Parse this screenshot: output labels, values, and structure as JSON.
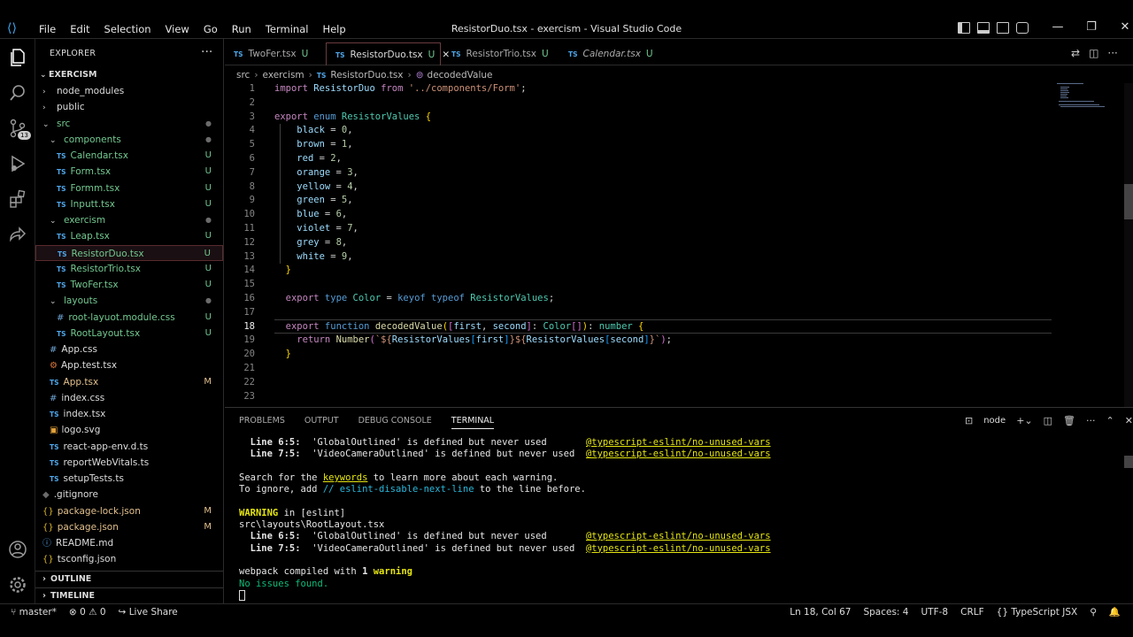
{
  "window": {
    "title": "ResistorDuo.tsx - exercism - Visual Studio Code",
    "menu": [
      "File",
      "Edit",
      "Selection",
      "View",
      "Go",
      "Run",
      "Terminal",
      "Help"
    ],
    "controls": [
      "—",
      "❐",
      "✕"
    ]
  },
  "activity": {
    "items": [
      "explorer-icon",
      "search-icon",
      "source-control-icon",
      "run-debug-icon",
      "extensions-icon",
      "live-share-icon"
    ],
    "scm_badge": "13",
    "bottom": [
      "account-icon",
      "manage-gear-icon"
    ]
  },
  "explorer": {
    "header": "EXPLORER",
    "more": "···",
    "root": "EXERCISM",
    "rows": [
      {
        "label": "node_modules",
        "kind": "folder-closed",
        "indent": 1,
        "deco": "",
        "color": ""
      },
      {
        "label": "public",
        "kind": "folder-closed",
        "indent": 1,
        "deco": "",
        "color": ""
      },
      {
        "label": "src",
        "kind": "folder-open",
        "indent": 1,
        "deco": "●",
        "color": "green"
      },
      {
        "label": "components",
        "kind": "folder-open",
        "indent": 2,
        "deco": "●",
        "color": "green"
      },
      {
        "label": "Calendar.tsx",
        "kind": "ts",
        "indent": 3,
        "deco": "U",
        "color": "green"
      },
      {
        "label": "Form.tsx",
        "kind": "ts",
        "indent": 3,
        "deco": "U",
        "color": "green"
      },
      {
        "label": "Formm.tsx",
        "kind": "ts",
        "indent": 3,
        "deco": "U",
        "color": "green"
      },
      {
        "label": "Inputt.tsx",
        "kind": "ts",
        "indent": 3,
        "deco": "U",
        "color": "green"
      },
      {
        "label": "exercism",
        "kind": "folder-open",
        "indent": 2,
        "deco": "●",
        "color": "green"
      },
      {
        "label": "Leap.tsx",
        "kind": "ts",
        "indent": 3,
        "deco": "U",
        "color": "green"
      },
      {
        "label": "ResistorDuo.tsx",
        "kind": "ts",
        "indent": 3,
        "deco": "U",
        "color": "green",
        "selected": true
      },
      {
        "label": "ResistorTrio.tsx",
        "kind": "ts",
        "indent": 3,
        "deco": "U",
        "color": "green"
      },
      {
        "label": "TwoFer.tsx",
        "kind": "ts",
        "indent": 3,
        "deco": "U",
        "color": "green"
      },
      {
        "label": "layouts",
        "kind": "folder-open",
        "indent": 2,
        "deco": "●",
        "color": "green"
      },
      {
        "label": "root-layuot.module.css",
        "kind": "css",
        "indent": 3,
        "deco": "U",
        "color": "green"
      },
      {
        "label": "RootLayout.tsx",
        "kind": "ts",
        "indent": 3,
        "deco": "U",
        "color": "green"
      },
      {
        "label": "App.css",
        "kind": "css",
        "indent": 2,
        "deco": "",
        "color": ""
      },
      {
        "label": "App.test.tsx",
        "kind": "test",
        "indent": 2,
        "deco": "",
        "color": ""
      },
      {
        "label": "App.tsx",
        "kind": "ts",
        "indent": 2,
        "deco": "M",
        "color": "yellow"
      },
      {
        "label": "index.css",
        "kind": "css",
        "indent": 2,
        "deco": "",
        "color": ""
      },
      {
        "label": "index.tsx",
        "kind": "ts",
        "indent": 2,
        "deco": "",
        "color": ""
      },
      {
        "label": "logo.svg",
        "kind": "svg",
        "indent": 2,
        "deco": "",
        "color": ""
      },
      {
        "label": "react-app-env.d.ts",
        "kind": "ts",
        "indent": 2,
        "deco": "",
        "color": ""
      },
      {
        "label": "reportWebVitals.ts",
        "kind": "ts",
        "indent": 2,
        "deco": "",
        "color": ""
      },
      {
        "label": "setupTests.ts",
        "kind": "ts",
        "indent": 2,
        "deco": "",
        "color": ""
      },
      {
        "label": ".gitignore",
        "kind": "git",
        "indent": 1,
        "deco": "",
        "color": ""
      },
      {
        "label": "package-lock.json",
        "kind": "json",
        "indent": 1,
        "deco": "M",
        "color": "yellow"
      },
      {
        "label": "package.json",
        "kind": "json",
        "indent": 1,
        "deco": "M",
        "color": "yellow"
      },
      {
        "label": "README.md",
        "kind": "md",
        "indent": 1,
        "deco": "",
        "color": ""
      },
      {
        "label": "tsconfig.json",
        "kind": "json",
        "indent": 1,
        "deco": "",
        "color": ""
      }
    ],
    "outline": "OUTLINE",
    "timeline": "TIMELINE"
  },
  "tabs": [
    {
      "label": "TwoFer.tsx",
      "badge": "U",
      "active": false,
      "italic": false
    },
    {
      "label": "ResistorDuo.tsx",
      "badge": "U",
      "active": true,
      "italic": false
    },
    {
      "label": "ResistorTrio.tsx",
      "badge": "U",
      "active": false,
      "italic": false
    },
    {
      "label": "Calendar.tsx",
      "badge": "U",
      "active": false,
      "italic": true
    }
  ],
  "breadcrumb": [
    "src",
    "exercism",
    "ResistorDuo.tsx",
    "decodedValue"
  ],
  "code": {
    "current_line": 18,
    "lines": [
      [
        [
          "kw2",
          "import "
        ],
        [
          "vr",
          "ResistorDuo"
        ],
        [
          "kw2",
          " from "
        ],
        [
          "st",
          "'../components/Form'"
        ],
        [
          "pl",
          ";"
        ]
      ],
      [],
      [
        [
          "kw2",
          "export "
        ],
        [
          "kw",
          "enum "
        ],
        [
          "ty",
          "ResistorValues "
        ],
        [
          "br",
          "{"
        ]
      ],
      [
        [
          "pl",
          "    "
        ],
        [
          "vr",
          "black"
        ],
        [
          "pl",
          " = "
        ],
        [
          "nm",
          "0"
        ],
        [
          "pl",
          ","
        ]
      ],
      [
        [
          "pl",
          "    "
        ],
        [
          "vr",
          "brown"
        ],
        [
          "pl",
          " = "
        ],
        [
          "nm",
          "1"
        ],
        [
          "pl",
          ","
        ]
      ],
      [
        [
          "pl",
          "    "
        ],
        [
          "vr",
          "red"
        ],
        [
          "pl",
          " = "
        ],
        [
          "nm",
          "2"
        ],
        [
          "pl",
          ","
        ]
      ],
      [
        [
          "pl",
          "    "
        ],
        [
          "vr",
          "orange"
        ],
        [
          "pl",
          " = "
        ],
        [
          "nm",
          "3"
        ],
        [
          "pl",
          ","
        ]
      ],
      [
        [
          "pl",
          "    "
        ],
        [
          "vr",
          "yellow"
        ],
        [
          "pl",
          " = "
        ],
        [
          "nm",
          "4"
        ],
        [
          "pl",
          ","
        ]
      ],
      [
        [
          "pl",
          "    "
        ],
        [
          "vr",
          "green"
        ],
        [
          "pl",
          " = "
        ],
        [
          "nm",
          "5"
        ],
        [
          "pl",
          ","
        ]
      ],
      [
        [
          "pl",
          "    "
        ],
        [
          "vr",
          "blue"
        ],
        [
          "pl",
          " = "
        ],
        [
          "nm",
          "6"
        ],
        [
          "pl",
          ","
        ]
      ],
      [
        [
          "pl",
          "    "
        ],
        [
          "vr",
          "violet"
        ],
        [
          "pl",
          " = "
        ],
        [
          "nm",
          "7"
        ],
        [
          "pl",
          ","
        ]
      ],
      [
        [
          "pl",
          "    "
        ],
        [
          "vr",
          "grey"
        ],
        [
          "pl",
          " = "
        ],
        [
          "nm",
          "8"
        ],
        [
          "pl",
          ","
        ]
      ],
      [
        [
          "pl",
          "    "
        ],
        [
          "vr",
          "white"
        ],
        [
          "pl",
          " = "
        ],
        [
          "nm",
          "9"
        ],
        [
          "pl",
          ","
        ]
      ],
      [
        [
          "pl",
          "  "
        ],
        [
          "br",
          "}"
        ]
      ],
      [],
      [
        [
          "pl",
          "  "
        ],
        [
          "kw2",
          "export "
        ],
        [
          "kw",
          "type "
        ],
        [
          "ty",
          "Color"
        ],
        [
          "pl",
          " = "
        ],
        [
          "kw",
          "keyof typeof "
        ],
        [
          "ty",
          "ResistorValues"
        ],
        [
          "pl",
          ";"
        ]
      ],
      [],
      [
        [
          "pl",
          "  "
        ],
        [
          "kw2",
          "export "
        ],
        [
          "kw",
          "function "
        ],
        [
          "fn",
          "decodedValue"
        ],
        [
          "br",
          "("
        ],
        [
          "br2",
          "["
        ],
        [
          "vr",
          "first"
        ],
        [
          "pl",
          ", "
        ],
        [
          "vr",
          "second"
        ],
        [
          "br2",
          "]"
        ],
        [
          "pl",
          ": "
        ],
        [
          "ty",
          "Color"
        ],
        [
          "br2",
          "[]"
        ],
        [
          "br",
          ")"
        ],
        [
          "pl",
          ": "
        ],
        [
          "ty",
          "number "
        ],
        [
          "br",
          "{"
        ]
      ],
      [
        [
          "pl",
          "    "
        ],
        [
          "kw2",
          "return "
        ],
        [
          "fn",
          "Number"
        ],
        [
          "br2",
          "("
        ],
        [
          "st",
          "`${"
        ],
        [
          "vr",
          "ResistorValues"
        ],
        [
          "br3",
          "["
        ],
        [
          "vr",
          "first"
        ],
        [
          "br3",
          "]"
        ],
        [
          "st",
          "}${"
        ],
        [
          "vr",
          "ResistorValues"
        ],
        [
          "br3",
          "["
        ],
        [
          "vr",
          "second"
        ],
        [
          "br3",
          "]"
        ],
        [
          "st",
          "}`"
        ],
        [
          "br2",
          ")"
        ],
        [
          "pl",
          ";"
        ]
      ],
      [
        [
          "pl",
          "  "
        ],
        [
          "br",
          "}"
        ]
      ],
      [],
      [],
      []
    ]
  },
  "panel": {
    "tabs": [
      "PROBLEMS",
      "OUTPUT",
      "DEBUG CONSOLE",
      "TERMINAL"
    ],
    "active_tab": "TERMINAL",
    "shell": "node",
    "terminal": [
      [
        [
          "tb",
          "  Line 6:5:  "
        ],
        [
          "",
          "'GlobalOutlined' is defined but never used       "
        ],
        [
          "ty2 tu",
          "@typescript-eslint/no-unused-vars"
        ]
      ],
      [
        [
          "tb",
          "  Line 7:5:  "
        ],
        [
          "",
          "'VideoCameraOutlined' is defined but never used  "
        ],
        [
          "ty2 tu",
          "@typescript-eslint/no-unused-vars"
        ]
      ],
      [
        [
          "",
          ""
        ]
      ],
      [
        [
          "",
          "Search for the "
        ],
        [
          "ty2 tu",
          "keywords"
        ],
        [
          "",
          ""
        ],
        [
          "",
          " to learn more about each warning."
        ]
      ],
      [
        [
          "",
          "To ignore, add "
        ],
        [
          "tc",
          "// eslint-disable-next-line"
        ],
        [
          "",
          " to the line before."
        ]
      ],
      [
        [
          "",
          ""
        ]
      ],
      [
        [
          "ty2 tb",
          "WARNING"
        ],
        [
          "",
          " in [eslint]"
        ]
      ],
      [
        [
          "",
          "src\\layouts\\RootLayout.tsx"
        ]
      ],
      [
        [
          "tb",
          "  Line 6:5:  "
        ],
        [
          "",
          "'GlobalOutlined' is defined but never used       "
        ],
        [
          "ty2 tu",
          "@typescript-eslint/no-unused-vars"
        ]
      ],
      [
        [
          "tb",
          "  Line 7:5:  "
        ],
        [
          "",
          "'VideoCameraOutlined' is defined but never used  "
        ],
        [
          "ty2 tu",
          "@typescript-eslint/no-unused-vars"
        ]
      ],
      [
        [
          "",
          ""
        ]
      ],
      [
        [
          "",
          "webpack compiled with "
        ],
        [
          "tb",
          "1"
        ],
        [
          "",
          " "
        ],
        [
          "ty2 tb",
          "warning"
        ]
      ],
      [
        [
          "tg",
          "No issues found."
        ]
      ]
    ]
  },
  "status": {
    "branch": "master*",
    "errors": "0",
    "warnings": "0",
    "live_share": "Live Share",
    "position": "Ln 18, Col 67",
    "spaces": "Spaces: 4",
    "encoding": "UTF-8",
    "eol": "CRLF",
    "language": "TypeScript JSX"
  }
}
